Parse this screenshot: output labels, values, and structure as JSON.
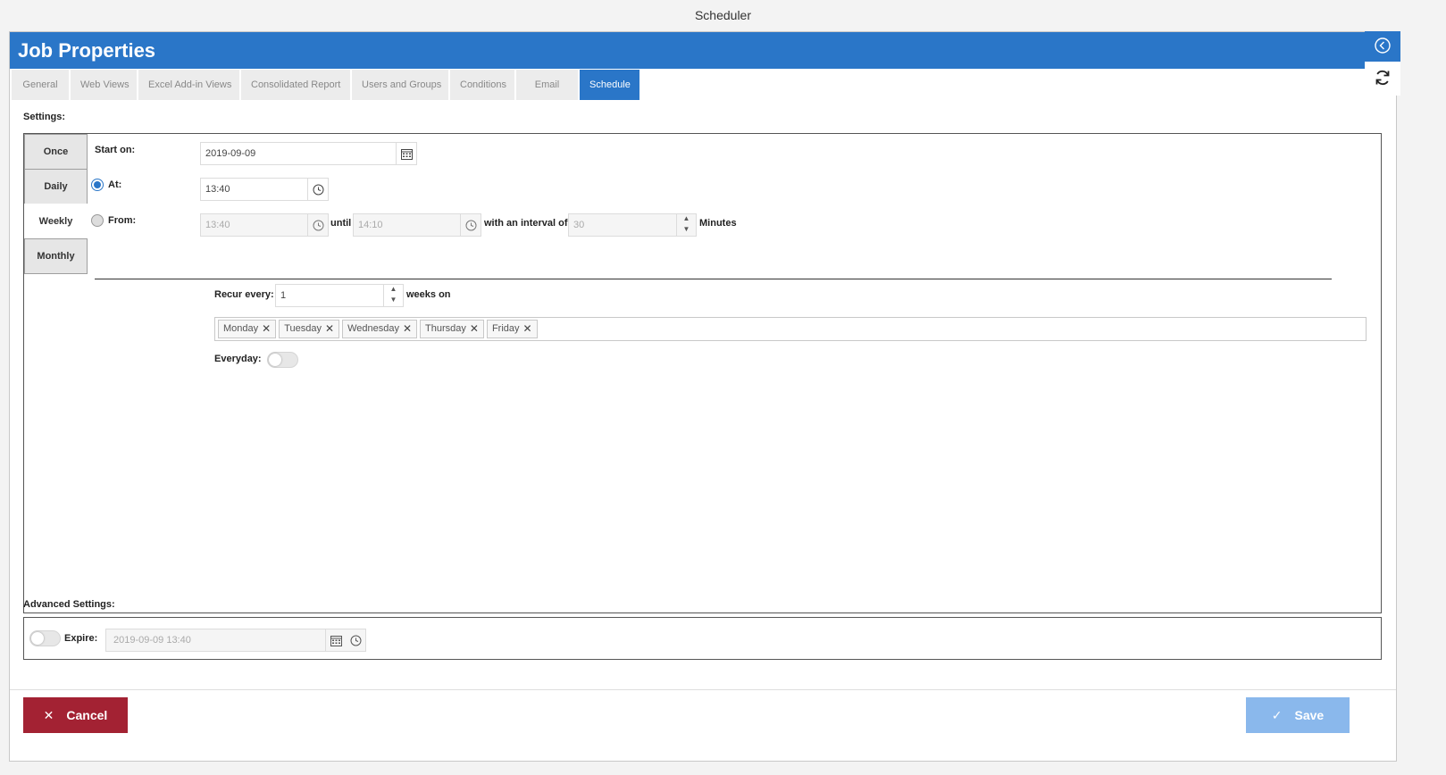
{
  "window": {
    "title": "Scheduler"
  },
  "dialog": {
    "title": "Job Properties"
  },
  "tabs": [
    {
      "label": "General",
      "active": false
    },
    {
      "label": "Web Views",
      "active": false
    },
    {
      "label": "Excel Add-in Views",
      "active": false
    },
    {
      "label": "Consolidated Report",
      "active": false
    },
    {
      "label": "Users and Groups",
      "active": false
    },
    {
      "label": "Conditions",
      "active": false
    },
    {
      "label": "Email",
      "active": false
    },
    {
      "label": "Schedule",
      "active": true
    }
  ],
  "settings": {
    "label": "Settings:",
    "frequency_tabs": [
      {
        "label": "Once",
        "active": false
      },
      {
        "label": "Daily",
        "active": false
      },
      {
        "label": "Weekly",
        "active": true
      },
      {
        "label": "Monthly",
        "active": false
      }
    ],
    "start_on": {
      "label": "Start on:",
      "value": "2019-09-09"
    },
    "at": {
      "label": "At:",
      "value": "13:40",
      "selected": true
    },
    "from": {
      "label": "From:",
      "value": "13:40",
      "selected": false
    },
    "until": {
      "label": "until",
      "value": "14:10"
    },
    "interval": {
      "label": "with an interval of",
      "value": "30",
      "unit": "Minutes"
    },
    "recur": {
      "label": "Recur every:",
      "value": "1",
      "suffix": "weeks on"
    },
    "days": [
      "Monday",
      "Tuesday",
      "Wednesday",
      "Thursday",
      "Friday"
    ],
    "everyday": {
      "label": "Everyday:",
      "on": false
    }
  },
  "advanced": {
    "label": "Advanced Settings:",
    "expire": {
      "label": "Expire:",
      "value": "2019-09-09 13:40",
      "on": false
    }
  },
  "buttons": {
    "cancel": "Cancel",
    "save": "Save"
  },
  "colors": {
    "primary": "#2a76c8",
    "cancel": "#a32233",
    "save_disabled": "#8ab8ec"
  }
}
